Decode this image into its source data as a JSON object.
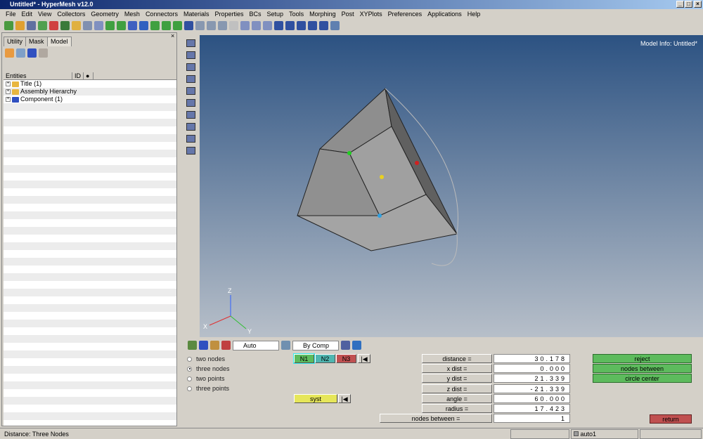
{
  "window": {
    "title": "Untitled* - HyperMesh v12.0"
  },
  "menu": [
    "File",
    "Edit",
    "View",
    "Collectors",
    "Geometry",
    "Mesh",
    "Connectors",
    "Materials",
    "Properties",
    "BCs",
    "Setup",
    "Tools",
    "Morphing",
    "Post",
    "XYPlots",
    "Preferences",
    "Applications",
    "Help"
  ],
  "left_panel": {
    "tabs": [
      "Utility",
      "Mask",
      "Model"
    ],
    "active_tab": "Model",
    "columns": [
      "Entities",
      "ID"
    ],
    "tree": [
      "Title (1)",
      "Assembly Hierarchy",
      "Component (1)"
    ]
  },
  "viewport": {
    "model_info": "Model Info: Untitled*",
    "axes": {
      "x": "X",
      "y": "Y",
      "z": "Z"
    }
  },
  "bottom_toolbar": {
    "vis_mode": "Auto",
    "color_mode": "By Comp"
  },
  "panel": {
    "options": [
      {
        "label": "two nodes",
        "selected": false
      },
      {
        "label": "three nodes",
        "selected": true
      },
      {
        "label": "two points",
        "selected": false
      },
      {
        "label": "three points",
        "selected": false
      }
    ],
    "node_buttons": [
      "N1",
      "N2",
      "N3"
    ],
    "syst": "syst",
    "fields": [
      {
        "label": "distance =",
        "value": "30.178"
      },
      {
        "label": "x dist  =",
        "value": "0.000"
      },
      {
        "label": "y dist  =",
        "value": "21.339"
      },
      {
        "label": "z dist  =",
        "value": "-21.339"
      },
      {
        "label": "angle  =",
        "value": "60.000"
      },
      {
        "label": "radius  =",
        "value": "17.423"
      }
    ],
    "nodes_between": {
      "label": "nodes between  =",
      "value": "1"
    },
    "actions": [
      "reject",
      "nodes between",
      "circle center"
    ],
    "return": "return",
    "colors": {
      "n1": "#5dbb5d",
      "n2": "#4fb6b0",
      "n3": "#c05050",
      "syst": "#e6e65a",
      "action": "#5dbb5d",
      "return": "#c05050"
    }
  },
  "status": {
    "message": "Distance:  Three Nodes",
    "component": "auto1"
  }
}
